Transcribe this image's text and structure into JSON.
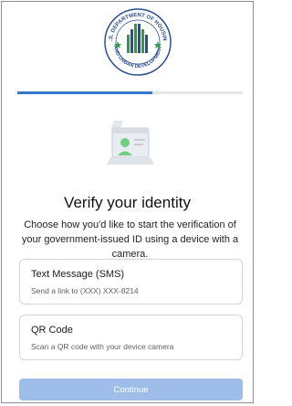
{
  "header": {
    "seal_text_top": "U.S. DEPARTMENT OF HOUSING",
    "seal_text_bottom": "AND URBAN DEVELOPMENT"
  },
  "progress": {
    "fraction": 0.6
  },
  "main": {
    "title": "Verify your identity",
    "subtitle": "Choose how you'd like to start the verification of your government-issued ID using a device with a camera."
  },
  "options": [
    {
      "title": "Text Message (SMS)",
      "description": "Send a link to (XXX) XXX-8214"
    },
    {
      "title": "QR Code",
      "description": "Scan a QR code with your device camera"
    }
  ],
  "footer": {
    "continue_label": "Continue"
  },
  "colors": {
    "accent": "#3a78d0",
    "button_disabled": "#9fbde9",
    "seal_green": "#2a9d4b",
    "seal_blue": "#2a4f8f"
  }
}
